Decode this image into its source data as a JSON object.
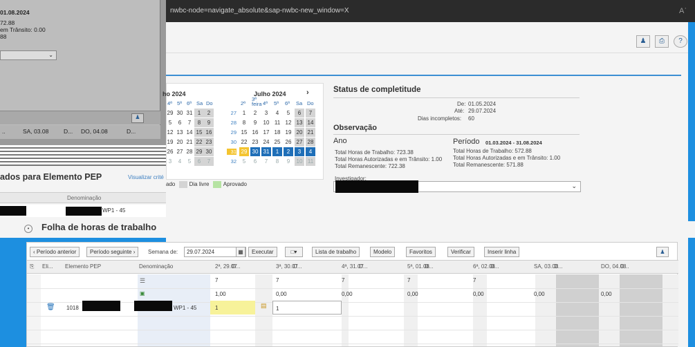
{
  "browser": {
    "url": "nwbc-node=navigate_absolute&sap-nwbc-new_window=X",
    "reader_icon": "Aʾ"
  },
  "toolbar_icons": [
    "person-plus-icon",
    "print-icon",
    "help-icon"
  ],
  "ghost_panel": {
    "lines": [
      "01.08.2024",
      "72.88",
      "em Trânsito: 0.00",
      "88"
    ],
    "row_cells": [
      "SA, 03.08",
      "D...",
      "DO, 04.08",
      "D..."
    ],
    "pep_title": "ados para Elemento PEP",
    "pep_link": "Visualizar crité",
    "pep_col": "Denominação",
    "pep_value": "WP1 - 45"
  },
  "calendar": {
    "month_left": "ho 2024",
    "month_right": "Julho 2024",
    "next_arrow": "›",
    "weekdays_left": [
      "4ª",
      "5ª",
      "6ª",
      "Sa",
      "Do"
    ],
    "weekdays_right": [
      "2ª",
      "3ª feira",
      "4ª",
      "5ª",
      "6ª",
      "Sa",
      "Do"
    ],
    "weeks_left": [
      [
        "29",
        "30",
        "31",
        "1",
        "2"
      ],
      [
        "5",
        "6",
        "7",
        "8",
        "9"
      ],
      [
        "12",
        "13",
        "14",
        "15",
        "16"
      ],
      [
        "19",
        "20",
        "21",
        "22",
        "23"
      ],
      [
        "26",
        "27",
        "28",
        "29",
        "30"
      ],
      [
        "3",
        "4",
        "5",
        "6",
        "7"
      ]
    ],
    "week_numbers": [
      "27",
      "28",
      "29",
      "30",
      "31",
      "32"
    ],
    "weeks_right": [
      [
        "1",
        "2",
        "3",
        "4",
        "5",
        "6",
        "7"
      ],
      [
        "8",
        "9",
        "10",
        "11",
        "12",
        "13",
        "14"
      ],
      [
        "15",
        "16",
        "17",
        "18",
        "19",
        "20",
        "21"
      ],
      [
        "22",
        "23",
        "24",
        "25",
        "26",
        "27",
        "28"
      ],
      [
        "29",
        "30",
        "31",
        "1",
        "2",
        "3",
        "4"
      ],
      [
        "5",
        "6",
        "7",
        "8",
        "9",
        "10",
        "11"
      ]
    ],
    "legend": {
      "prefix": "ado",
      "free": "Dia livre",
      "approved": "Aprovado"
    }
  },
  "status": {
    "title": "Status de completitude",
    "de_label": "De:",
    "de_value": "01.05.2024",
    "ate_label": "Até:",
    "ate_value": "29.07.2024",
    "incomplete_label": "Dias incompletos:",
    "incomplete_value": "60",
    "obs_title": "Observação",
    "year_label": "Ano",
    "period_label": "Período",
    "period_range": "01.03.2024 - 31.08.2024",
    "year_lines": [
      "Total Horas de Trabalho: 723.38",
      "Total Horas Autorizadas e em Trânsito: 1.00",
      "Total Remanescente: 722.38"
    ],
    "period_lines": [
      "Total Horas de Trabalho: 572.88",
      "Total Horas Autorizadas e em Trânsito: 1.00",
      "Total Remanescente: 571.88"
    ],
    "investigator_label": "Investigador:"
  },
  "timesheet": {
    "title": "Folha de horas de trabalho",
    "toolbar": {
      "prev": "‹ Período anterior",
      "next": "Período seguinte ›",
      "week_label": "Semana de:",
      "week_value": "29.07.2024",
      "execute": "Executar",
      "worklist": "Lista de trabalho",
      "model": "Modelo",
      "favorites": "Favoritos",
      "verify": "Verificar",
      "insert": "Inserir linha"
    },
    "headers": [
      "Eli...",
      "Elemento PEP",
      "Denominação",
      "2ª, 29.07",
      "D...",
      "3ª, 30.07",
      "D...",
      "4ª, 31.07",
      "D...",
      "5ª, 01.08",
      "D...",
      "6ª, 02.08",
      "D...",
      "SA, 03.08",
      "D...",
      "DO, 04.08",
      "D..."
    ],
    "target_row": [
      "7",
      "7",
      "7",
      "7",
      "7"
    ],
    "recorded_row": [
      "1,00",
      "0,00",
      "0,00",
      "0,00",
      "0,00",
      "0,00",
      "0,00"
    ],
    "entry": {
      "pep": "1018",
      "denom": "WP1 - 45",
      "mon": "1",
      "tue": "1"
    }
  }
}
